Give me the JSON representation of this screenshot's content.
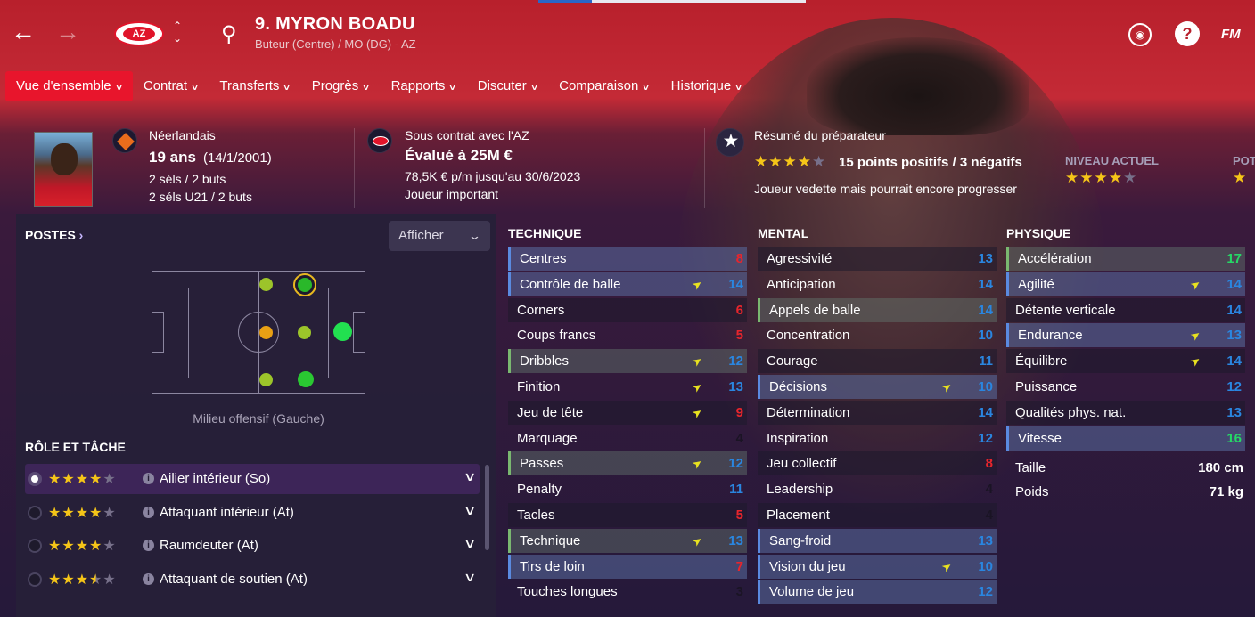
{
  "header": {
    "player_title": "9. MYRON BOADU",
    "player_subtitle": "Buteur (Centre) / MO (DG) - AZ",
    "club_badge": "AZ",
    "help": "?",
    "fm": "FM"
  },
  "nav": {
    "tabs": [
      "Vue d'ensemble",
      "Contrat",
      "Transferts",
      "Progrès",
      "Rapports",
      "Discuter",
      "Comparaison",
      "Historique"
    ]
  },
  "info": {
    "nationality": "Néerlandais",
    "age": "19 ans",
    "dob": "(14/1/2001)",
    "caps": "2 séls / 2 buts",
    "caps_u21": "2 séls U21 / 2 buts",
    "contract": "Sous contrat avec l'AZ",
    "value": "Évalué à 25M €",
    "wage": "78,5K € p/m jusqu'au 30/6/2023",
    "status": "Joueur important",
    "coach_title": "Résumé du préparateur",
    "coach_summary": "15 points positifs / 3 négatifs",
    "coach_desc": "Joueur vedette mais pourrait encore progresser",
    "current_label": "NIVEAU ACTUEL",
    "potential_label": "POT",
    "coach_stars": 4,
    "current_stars": 4
  },
  "positions": {
    "title": "POSTES",
    "afficher": "Afficher",
    "position_name": "Milieu offensif (Gauche)"
  },
  "roles": {
    "title": "RÔLE ET TÂCHE",
    "items": [
      {
        "name": "Ailier intérieur (So)",
        "stars": 4
      },
      {
        "name": "Attaquant intérieur (At)",
        "stars": 4
      },
      {
        "name": "Raumdeuter (At)",
        "stars": 4
      },
      {
        "name": "Attaquant de soutien (At)",
        "stars": 3.5
      }
    ]
  },
  "technique": {
    "title": "TECHNIQUE",
    "rows": [
      {
        "n": "Centres",
        "v": "8",
        "c": "#e8252c",
        "s": "hl"
      },
      {
        "n": "Contrôle de balle",
        "v": "14",
        "c": "#2a86e0",
        "s": "hl",
        "a": 1
      },
      {
        "n": "Corners",
        "v": "6",
        "c": "#e8252c",
        "s": "odd"
      },
      {
        "n": "Coups francs",
        "v": "5",
        "c": "#e8252c",
        "s": ""
      },
      {
        "n": "Dribbles",
        "v": "12",
        "c": "#2a86e0",
        "s": "hlg",
        "a": 1
      },
      {
        "n": "Finition",
        "v": "13",
        "c": "#2a86e0",
        "s": "",
        "a": 1
      },
      {
        "n": "Jeu de tête",
        "v": "9",
        "c": "#e8252c",
        "s": "odd",
        "a": 1
      },
      {
        "n": "Marquage",
        "v": "4",
        "c": "#1a1424",
        "s": ""
      },
      {
        "n": "Passes",
        "v": "12",
        "c": "#2a86e0",
        "s": "hlg",
        "a": 1
      },
      {
        "n": "Penalty",
        "v": "11",
        "c": "#2a86e0",
        "s": ""
      },
      {
        "n": "Tacles",
        "v": "5",
        "c": "#e8252c",
        "s": "odd"
      },
      {
        "n": "Technique",
        "v": "13",
        "c": "#2a86e0",
        "s": "hlg",
        "a": 1
      },
      {
        "n": "Tirs de loin",
        "v": "7",
        "c": "#e8252c",
        "s": "hl"
      },
      {
        "n": "Touches longues",
        "v": "3",
        "c": "#1a1424",
        "s": ""
      }
    ]
  },
  "mental": {
    "title": "MENTAL",
    "rows": [
      {
        "n": "Agressivité",
        "v": "13",
        "c": "#2a86e0",
        "s": "odd"
      },
      {
        "n": "Anticipation",
        "v": "14",
        "c": "#2a86e0",
        "s": ""
      },
      {
        "n": "Appels de balle",
        "v": "14",
        "c": "#2a86e0",
        "s": "hlg"
      },
      {
        "n": "Concentration",
        "v": "10",
        "c": "#2a86e0",
        "s": ""
      },
      {
        "n": "Courage",
        "v": "11",
        "c": "#2a86e0",
        "s": "odd"
      },
      {
        "n": "Décisions",
        "v": "10",
        "c": "#2a86e0",
        "s": "hl",
        "a": 1
      },
      {
        "n": "Détermination",
        "v": "14",
        "c": "#2a86e0",
        "s": "odd"
      },
      {
        "n": "Inspiration",
        "v": "12",
        "c": "#2a86e0",
        "s": ""
      },
      {
        "n": "Jeu collectif",
        "v": "8",
        "c": "#e8252c",
        "s": "odd"
      },
      {
        "n": "Leadership",
        "v": "4",
        "c": "#1a1424",
        "s": ""
      },
      {
        "n": "Placement",
        "v": "4",
        "c": "#1a1424",
        "s": "odd"
      },
      {
        "n": "Sang-froid",
        "v": "13",
        "c": "#2a86e0",
        "s": "hl"
      },
      {
        "n": "Vision du jeu",
        "v": "10",
        "c": "#2a86e0",
        "s": "hl",
        "a": 1
      },
      {
        "n": "Volume de jeu",
        "v": "12",
        "c": "#2a86e0",
        "s": "hl"
      }
    ]
  },
  "physique": {
    "title": "PHYSIQUE",
    "rows": [
      {
        "n": "Accélération",
        "v": "17",
        "c": "#26d866",
        "s": "hlg"
      },
      {
        "n": "Agilité",
        "v": "14",
        "c": "#2a86e0",
        "s": "hl",
        "a": 1
      },
      {
        "n": "Détente verticale",
        "v": "14",
        "c": "#2a86e0",
        "s": "odd"
      },
      {
        "n": "Endurance",
        "v": "13",
        "c": "#2a86e0",
        "s": "hl",
        "a": 1
      },
      {
        "n": "Équilibre",
        "v": "14",
        "c": "#2a86e0",
        "s": "odd",
        "a": 1
      },
      {
        "n": "Puissance",
        "v": "12",
        "c": "#2a86e0",
        "s": ""
      },
      {
        "n": "Qualités phys. nat.",
        "v": "13",
        "c": "#2a86e0",
        "s": "odd"
      },
      {
        "n": "Vitesse",
        "v": "16",
        "c": "#26d866",
        "s": "hl"
      }
    ],
    "height_label": "Taille",
    "height": "180 cm",
    "weight_label": "Poids",
    "weight": "71 kg"
  }
}
